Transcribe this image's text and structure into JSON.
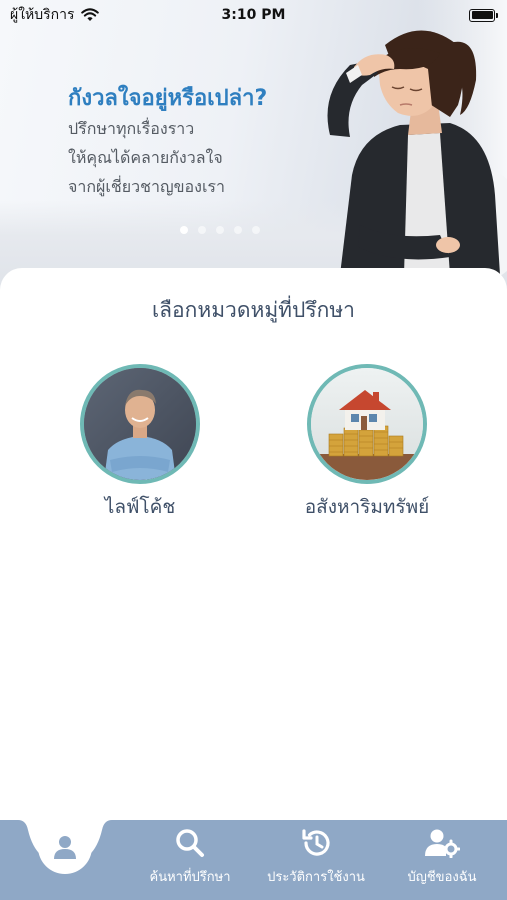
{
  "status_bar": {
    "carrier": "ผู้ให้บริการ",
    "time": "3:10 PM"
  },
  "hero": {
    "title": "กังวลใจอยู่หรือเปล่า?",
    "lines": [
      "ปรึกษาทุกเรื่องราว",
      "ให้คุณได้คลายกังวลใจ",
      "จากผู้เชี่ยวชาญของเรา"
    ],
    "carousel_page": 1,
    "carousel_count": 5
  },
  "main": {
    "section_title": "เลือกหมวดหมู่ที่ปรึกษา",
    "categories": [
      {
        "label": "ไลฟ์โค้ช",
        "icon": "life-coach-photo"
      },
      {
        "label": "อสังหาริมทรัพย์",
        "icon": "real-estate-photo"
      }
    ]
  },
  "bottom_nav": {
    "home_icon": "user-icon",
    "items": [
      {
        "label": "ค้นหาที่ปรึกษา",
        "icon": "search-icon"
      },
      {
        "label": "ประวัติการใช้งาน",
        "icon": "history-icon"
      },
      {
        "label": "บัญชีของฉัน",
        "icon": "account-settings-icon"
      }
    ]
  },
  "colors": {
    "accent_blue": "#2f7fc0",
    "nav_background": "#8fa8c6",
    "category_ring": "#6fb9b5",
    "heading_text": "#3f5068"
  }
}
